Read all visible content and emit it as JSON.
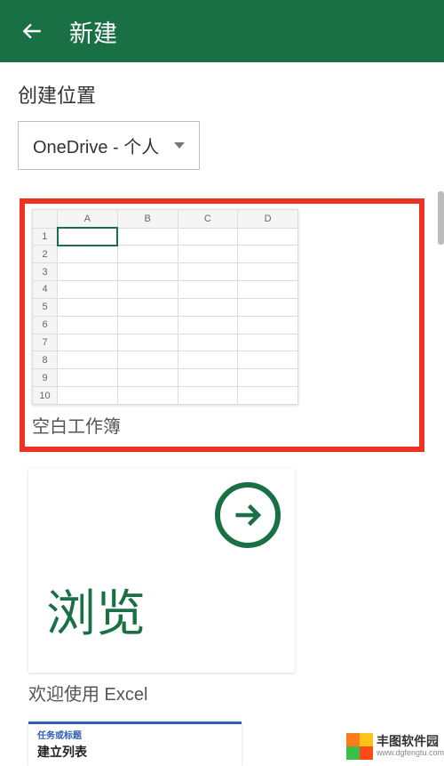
{
  "header": {
    "title": "新建"
  },
  "location": {
    "label": "创建位置",
    "selected": "OneDrive - 个人"
  },
  "templates": {
    "blank": {
      "label": "空白工作簿",
      "columns": [
        "A",
        "B",
        "C",
        "D"
      ],
      "rows": [
        "1",
        "2",
        "3",
        "4",
        "5",
        "6",
        "7",
        "8",
        "9",
        "10"
      ]
    },
    "welcome": {
      "big_text": "浏览",
      "label": "欢迎使用 Excel"
    },
    "list": {
      "line1": "任务或标题",
      "line2": "建立列表"
    }
  },
  "watermark": {
    "name": "丰图软件园",
    "url": "www.dgfengtu.com"
  },
  "colors": {
    "brand": "#1a7045",
    "highlight": "#ee3222"
  }
}
